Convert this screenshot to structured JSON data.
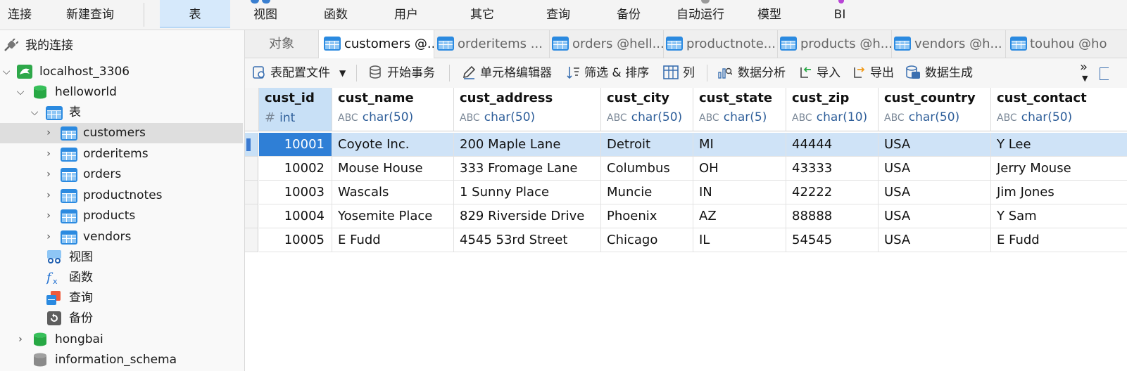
{
  "menu": {
    "items": [
      "连接",
      "新建查询",
      "表",
      "视图",
      "函数",
      "用户",
      "其它",
      "查询",
      "备份",
      "自动运行",
      "模型",
      "BI"
    ],
    "active": "表"
  },
  "sidebar": {
    "header": "我的连接",
    "connection": "localhost_3306",
    "database": "helloworld",
    "tables_group": "表",
    "tables": [
      "customers",
      "orderitems",
      "orders",
      "productnotes",
      "products",
      "vendors"
    ],
    "groups": [
      "视图",
      "函数",
      "查询",
      "备份"
    ],
    "other_dbs": [
      "hongbai",
      "information_schema"
    ]
  },
  "tabs": {
    "objects": "对象",
    "items": [
      "customers @...",
      "orderitems ...",
      "orders @hell...",
      "productnote...",
      "products @h...",
      "vendors @h...",
      "touhou @ho"
    ]
  },
  "toolbar": {
    "profile": "表配置文件",
    "begin_tx": "开始事务",
    "cell_editor": "单元格编辑器",
    "filter_sort": "筛选 & 排序",
    "columns": "列",
    "analysis": "数据分析",
    "import": "导入",
    "export": "导出",
    "generate": "数据生成",
    "more": "»"
  },
  "grid": {
    "columns": [
      {
        "name": "cust_id",
        "type": "int"
      },
      {
        "name": "cust_name",
        "type": "char(50)"
      },
      {
        "name": "cust_address",
        "type": "char(50)"
      },
      {
        "name": "cust_city",
        "type": "char(50)"
      },
      {
        "name": "cust_state",
        "type": "char(5)"
      },
      {
        "name": "cust_zip",
        "type": "char(10)"
      },
      {
        "name": "cust_country",
        "type": "char(50)"
      },
      {
        "name": "cust_contact",
        "type": "char(50)"
      }
    ],
    "rows": [
      [
        "10001",
        "Coyote Inc.",
        "200 Maple Lane",
        "Detroit",
        "MI",
        "44444",
        "USA",
        "Y Lee"
      ],
      [
        "10002",
        "Mouse House",
        "333 Fromage Lane",
        "Columbus",
        "OH",
        "43333",
        "USA",
        "Jerry Mouse"
      ],
      [
        "10003",
        "Wascals",
        "1 Sunny Place",
        "Muncie",
        "IN",
        "42222",
        "USA",
        "Jim Jones"
      ],
      [
        "10004",
        "Yosemite Place",
        "829 Riverside Drive",
        "Phoenix",
        "AZ",
        "88888",
        "USA",
        "Y Sam"
      ],
      [
        "10005",
        "E Fudd",
        "4545 53rd Street",
        "Chicago",
        "IL",
        "54545",
        "USA",
        "E Fudd"
      ]
    ],
    "selected_row": 0
  },
  "colors": {
    "accent": "#2f7fd6",
    "selection": "#cfe3f7",
    "table_icon": "#2b8ae0",
    "db_icon": "#27a844"
  }
}
